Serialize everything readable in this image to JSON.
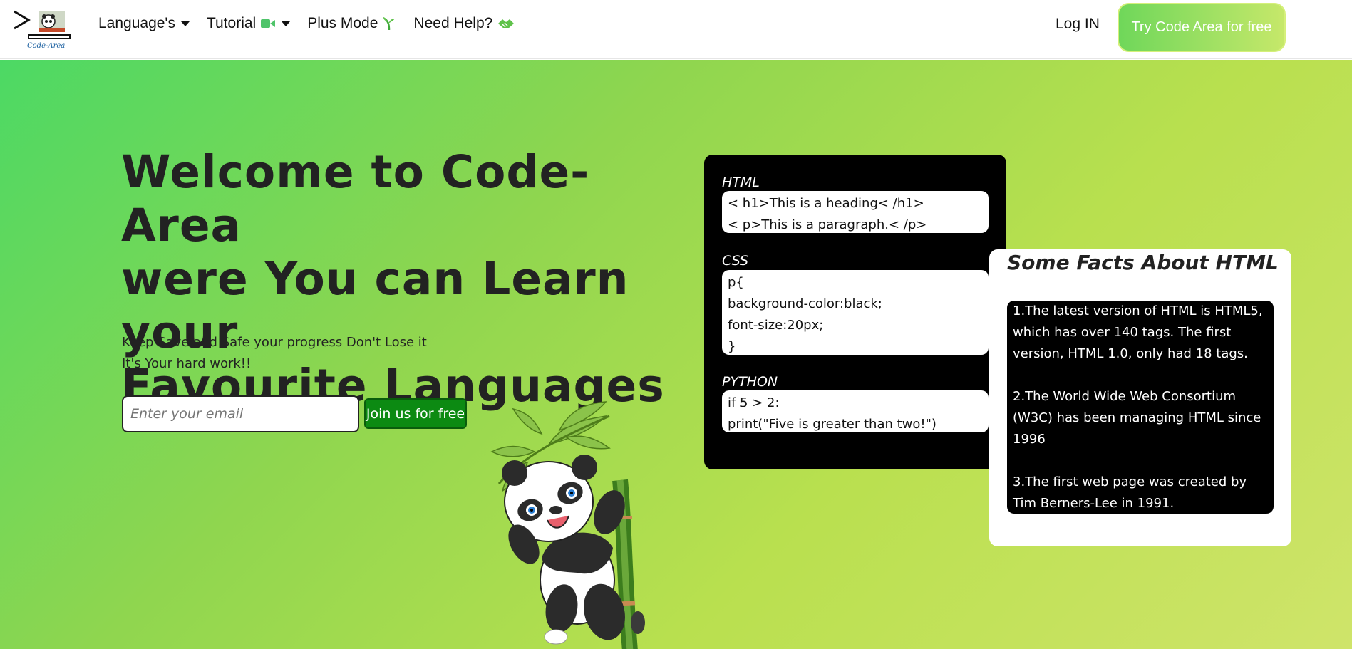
{
  "nav": {
    "logo_text": "Code-Area",
    "items": [
      {
        "label": "Language's",
        "icon": "caret-down-icon"
      },
      {
        "label": "Tutorial",
        "icon": "video-camera-icon"
      },
      {
        "label": "Plus Mode",
        "icon": "plant-icon"
      },
      {
        "label": "Need Help?",
        "icon": "handshake-icon"
      }
    ],
    "login": "Log IN",
    "cta": "Try Code Area for free"
  },
  "hero": {
    "title_lines": [
      "Welcome to Code-Area",
      "were You can Learn your",
      "Favourite Languages"
    ],
    "subtitle_lines": [
      "Keep Save and Safe your progress Don't Lose it",
      "It's Your hard work!!"
    ],
    "email_placeholder": "Enter your email",
    "join_label": "Join us for free"
  },
  "code_card": {
    "blocks": [
      {
        "label": "HTML",
        "lines": [
          "< h1>This is a heading< /h1>",
          "< p>This is a paragraph.< /p>"
        ]
      },
      {
        "label": "CSS",
        "lines": [
          "p{",
          "background-color:black;",
          "font-size:20px;",
          "}"
        ]
      },
      {
        "label": "PYTHON",
        "lines": [
          "if 5 > 2:",
          "print(\"Five is greater than two!\")"
        ]
      }
    ]
  },
  "facts": {
    "title": "Some Facts About HTML",
    "items": [
      "1.The latest version of HTML is HTML5, which has over 140 tags. The first version, HTML 1.0, only had 18 tags.",
      "2.The World Wide Web Consortium (W3C) has been managing HTML since 1996",
      "3.The first web page was created by Tim Berners-Lee in 1991."
    ]
  },
  "colors": {
    "accent_green": "#0c8a12",
    "hero_gradient_start": "#4cd964",
    "hero_gradient_end": "#cfe46a"
  }
}
